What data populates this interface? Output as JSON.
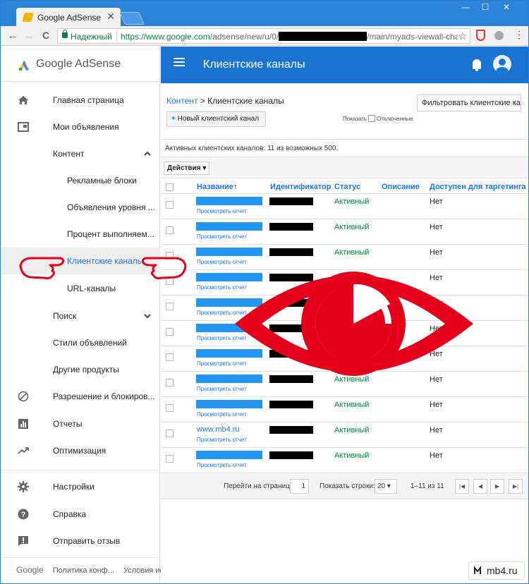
{
  "browser": {
    "tab_title": "Google AdSense",
    "tab_close": "✕",
    "win_min": "—",
    "win_max": "☐",
    "win_close": "✕",
    "back": "←",
    "forward": "→",
    "reload": "C",
    "secure_label": "Надежный",
    "url_prefix": "https://www.google.com",
    "url_mid": "/adsense/new/u/0/",
    "url_suffix": "/main/myads-viewall-channe",
    "star": "☆",
    "menu": "⋮"
  },
  "sidebar": {
    "brand": "Google AdSense",
    "items": [
      {
        "label": "Главная страница",
        "icon": "home-icon"
      },
      {
        "label": "Мои объявления",
        "icon": "ads-icon"
      },
      {
        "label": "Контент",
        "chevron": "^"
      },
      {
        "label": "Рекламные блоки"
      },
      {
        "label": "Объявления уровня ..."
      },
      {
        "label": "Процент выполняем..."
      },
      {
        "label": "Клиентские каналы"
      },
      {
        "label": "URL-каналы"
      },
      {
        "label": "Поиск",
        "chevron": "v"
      },
      {
        "label": "Стили объявлений"
      },
      {
        "label": "Другие продукты"
      },
      {
        "label": "Разрешение и блокиров...",
        "icon": "block-icon"
      },
      {
        "label": "Отчеты",
        "icon": "reports-icon"
      },
      {
        "label": "Оптимизация",
        "icon": "trending-icon"
      },
      {
        "label": "Настройки",
        "icon": "settings-icon"
      },
      {
        "label": "Справка",
        "icon": "help-icon"
      },
      {
        "label": "Отправить отзыв",
        "icon": "feedback-icon"
      }
    ],
    "footer": {
      "google": "Google",
      "privacy": "Политика конф...",
      "terms": "Условия ис..."
    }
  },
  "header": {
    "title": "Клиентские каналы"
  },
  "content": {
    "breadcrumb_link": "Контент",
    "breadcrumb_sep": " > ",
    "breadcrumb_current": "Клиентские каналы",
    "filter_button": "Фильтровать клиентские ка",
    "new_button_plus": "+",
    "new_button": "Новый клиентский канал",
    "show_label": "Показать",
    "show_disabled": "Отключенные",
    "info": "Активных клиентских каналов: 11 из возможных 500.",
    "actions": "Действия ▾"
  },
  "table": {
    "headers": {
      "name": "Название",
      "sort": "↑",
      "id": "Идентификатор",
      "status": "Статус",
      "description": "Описание",
      "targeting": "Доступен для таргетинга"
    },
    "rows": [
      {
        "name": "",
        "report": "Просмотреть отчет",
        "status": "Активный",
        "targeting": "Нет"
      },
      {
        "name": "",
        "report": "Просмотреть отчет",
        "status": "Активный",
        "targeting": "Нет"
      },
      {
        "name": "",
        "report": "Просмотреть отчет",
        "status": "Активный",
        "targeting": "Нет"
      },
      {
        "name": "",
        "report": "Просмотреть отчет",
        "status": "Активный",
        "targeting": "Нет"
      },
      {
        "name": "",
        "report": "Просмотреть отчет",
        "status": "Активный",
        "targeting": "Нет"
      },
      {
        "name": "",
        "report": "Просмотреть отчет",
        "status": "Активный",
        "targeting": "Нет"
      },
      {
        "name": "",
        "report": "Просмотреть отчет",
        "status": "Активный",
        "targeting": "Нет"
      },
      {
        "name": "",
        "report": "Просмотреть отчет",
        "status": "Активный",
        "targeting": "Нет"
      },
      {
        "name": "",
        "report": "Просмотреть отчет",
        "status": "Активный",
        "targeting": "Нет"
      },
      {
        "name": "www.mb4.ru",
        "report": "Просмотреть отчет",
        "status": "Активный",
        "targeting": "Нет"
      },
      {
        "name": "",
        "report": "Просмотреть отчет",
        "status": "Активный",
        "targeting": "Нет"
      }
    ]
  },
  "pager": {
    "goto_label": "Перейти на страницу:",
    "page": "1",
    "rows_label": "Показать строки:",
    "rows_value": "20 ▾",
    "range": "1–11 из 11",
    "first": "|◀",
    "prev": "◀",
    "next": "▶",
    "last": "▶|"
  },
  "watermark": {
    "text": "mb4.ru"
  },
  "colors": {
    "header_blue": "#1a73d1",
    "link_blue": "#1a73e8",
    "active_green": "#0b8043",
    "annotation_red": "#e4001b"
  }
}
